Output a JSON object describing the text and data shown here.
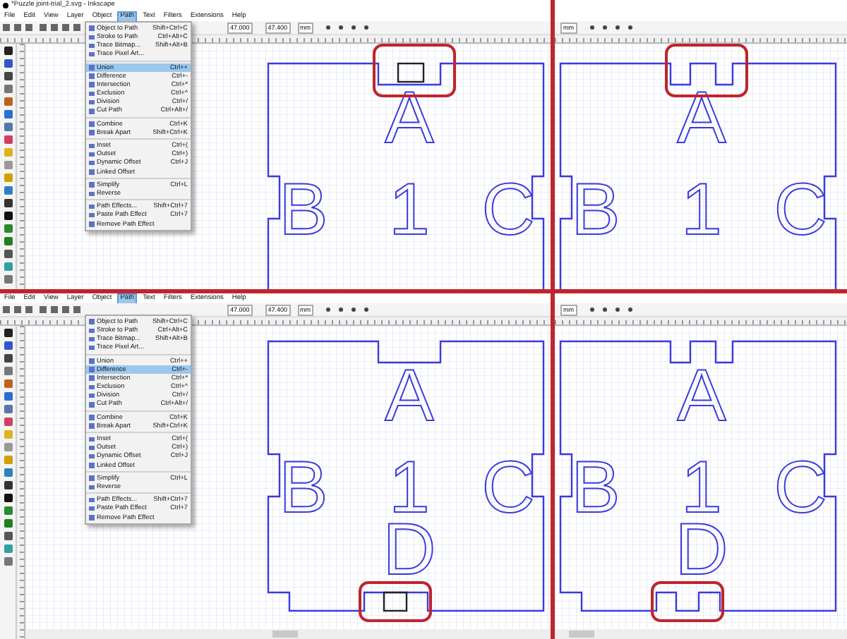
{
  "panels": [
    {
      "title": "*Puzzle joint-trial_2.svg - Inkscape",
      "menubar": [
        {
          "label": "File",
          "selected": false
        },
        {
          "label": "Edit",
          "selected": false
        },
        {
          "label": "View",
          "selected": false
        },
        {
          "label": "Layer",
          "selected": false
        },
        {
          "label": "Object",
          "selected": false
        },
        {
          "label": "Path",
          "selected": true
        },
        {
          "label": "Text",
          "selected": false
        },
        {
          "label": "Filters",
          "selected": false
        },
        {
          "label": "Extensions",
          "selected": false
        },
        {
          "label": "Help",
          "selected": false
        }
      ],
      "toolbar_fields": [
        "47.000",
        "47.400"
      ],
      "unit": "mm",
      "path_menu": [
        [
          {
            "label": "Object to Path",
            "shortcut": "Shift+Ctrl+C",
            "selected": false
          },
          {
            "label": "Stroke to Path",
            "shortcut": "Ctrl+Alt+C",
            "selected": false
          },
          {
            "label": "Trace Bitmap...",
            "shortcut": "Shift+Alt+B",
            "selected": false
          },
          {
            "label": "Trace Pixel Art...",
            "selected": false
          }
        ],
        [
          {
            "label": "Union",
            "shortcut": "Ctrl++",
            "selected": true
          },
          {
            "label": "Difference",
            "shortcut": "Ctrl+-",
            "selected": false
          },
          {
            "label": "Intersection",
            "shortcut": "Ctrl+*",
            "selected": false
          },
          {
            "label": "Exclusion",
            "shortcut": "Ctrl+^",
            "selected": false
          },
          {
            "label": "Division",
            "shortcut": "Ctrl+/",
            "selected": false
          },
          {
            "label": "Cut Path",
            "shortcut": "Ctrl+Alt+/",
            "selected": false
          }
        ],
        [
          {
            "label": "Combine",
            "shortcut": "Ctrl+K",
            "selected": false
          },
          {
            "label": "Break Apart",
            "shortcut": "Shift+Ctrl+K",
            "selected": false
          }
        ],
        [
          {
            "label": "Inset",
            "shortcut": "Ctrl+(",
            "selected": false
          },
          {
            "label": "Outset",
            "shortcut": "Ctrl+)",
            "selected": false
          },
          {
            "label": "Dynamic Offset",
            "shortcut": "Ctrl+J",
            "selected": false
          },
          {
            "label": "Linked Offset",
            "selected": false
          }
        ],
        [
          {
            "label": "Simplify",
            "shortcut": "Ctrl+L",
            "selected": false
          },
          {
            "label": "Reverse",
            "selected": false
          }
        ],
        [
          {
            "label": "Path Effects...",
            "shortcut": "Shift+Ctrl+7",
            "selected": false
          },
          {
            "label": "Paste Path Effect",
            "shortcut": "Ctrl+7",
            "selected": false
          },
          {
            "label": "Remove Path Effect",
            "selected": false
          }
        ]
      ],
      "canvas": {
        "letters": [
          "A",
          "B",
          "1",
          "C"
        ],
        "tab_merged": false,
        "top_highlighted": true
      }
    },
    {
      "unit": "mm",
      "canvas": {
        "letters": [
          "A",
          "B",
          "1",
          "C"
        ],
        "tab_merged": true,
        "top_highlighted": true
      }
    },
    {
      "menubar": [
        {
          "label": "File",
          "selected": false
        },
        {
          "label": "Edit",
          "selected": false
        },
        {
          "label": "View",
          "selected": false
        },
        {
          "label": "Layer",
          "selected": false
        },
        {
          "label": "Object",
          "selected": false
        },
        {
          "label": "Path",
          "selected": true
        },
        {
          "label": "Text",
          "selected": false
        },
        {
          "label": "Filters",
          "selected": false
        },
        {
          "label": "Extensions",
          "selected": false
        },
        {
          "label": "Help",
          "selected": false
        }
      ],
      "toolbar_fields": [
        "47.000",
        "47.400"
      ],
      "unit": "mm",
      "path_menu": [
        [
          {
            "label": "Object to Path",
            "shortcut": "Shift+Ctrl+C",
            "selected": false
          },
          {
            "label": "Stroke to Path",
            "shortcut": "Ctrl+Alt+C",
            "selected": false
          },
          {
            "label": "Trace Bitmap...",
            "shortcut": "Shift+Alt+B",
            "selected": false
          },
          {
            "label": "Trace Pixel Art...",
            "selected": false
          }
        ],
        [
          {
            "label": "Union",
            "shortcut": "Ctrl++",
            "selected": false
          },
          {
            "label": "Difference",
            "shortcut": "Ctrl+-",
            "selected": true
          },
          {
            "label": "Intersection",
            "shortcut": "Ctrl+*",
            "selected": false
          },
          {
            "label": "Exclusion",
            "shortcut": "Ctrl+^",
            "selected": false
          },
          {
            "label": "Division",
            "shortcut": "Ctrl+/",
            "selected": false
          },
          {
            "label": "Cut Path",
            "shortcut": "Ctrl+Alt+/",
            "selected": false
          }
        ],
        [
          {
            "label": "Combine",
            "shortcut": "Ctrl+K",
            "selected": false
          },
          {
            "label": "Break Apart",
            "shortcut": "Shift+Ctrl+K",
            "selected": false
          }
        ],
        [
          {
            "label": "Inset",
            "shortcut": "Ctrl+(",
            "selected": false
          },
          {
            "label": "Outset",
            "shortcut": "Ctrl+)",
            "selected": false
          },
          {
            "label": "Dynamic Offset",
            "shortcut": "Ctrl+J",
            "selected": false
          },
          {
            "label": "Linked Offset",
            "selected": false
          }
        ],
        [
          {
            "label": "Simplify",
            "shortcut": "Ctrl+L",
            "selected": false
          },
          {
            "label": "Reverse",
            "selected": false
          }
        ],
        [
          {
            "label": "Path Effects...",
            "shortcut": "Shift+Ctrl+7",
            "selected": false
          },
          {
            "label": "Paste Path Effect",
            "shortcut": "Ctrl+7",
            "selected": false
          },
          {
            "label": "Remove Path Effect",
            "selected": false
          }
        ]
      ],
      "canvas": {
        "letters": [
          "A",
          "B",
          "1",
          "C",
          "D"
        ],
        "tab_merged": false,
        "bottom_highlighted": true
      }
    },
    {
      "unit": "mm",
      "canvas": {
        "letters": [
          "A",
          "B",
          "1",
          "C",
          "D"
        ],
        "tab_merged": true,
        "bottom_highlighted": true
      }
    }
  ]
}
